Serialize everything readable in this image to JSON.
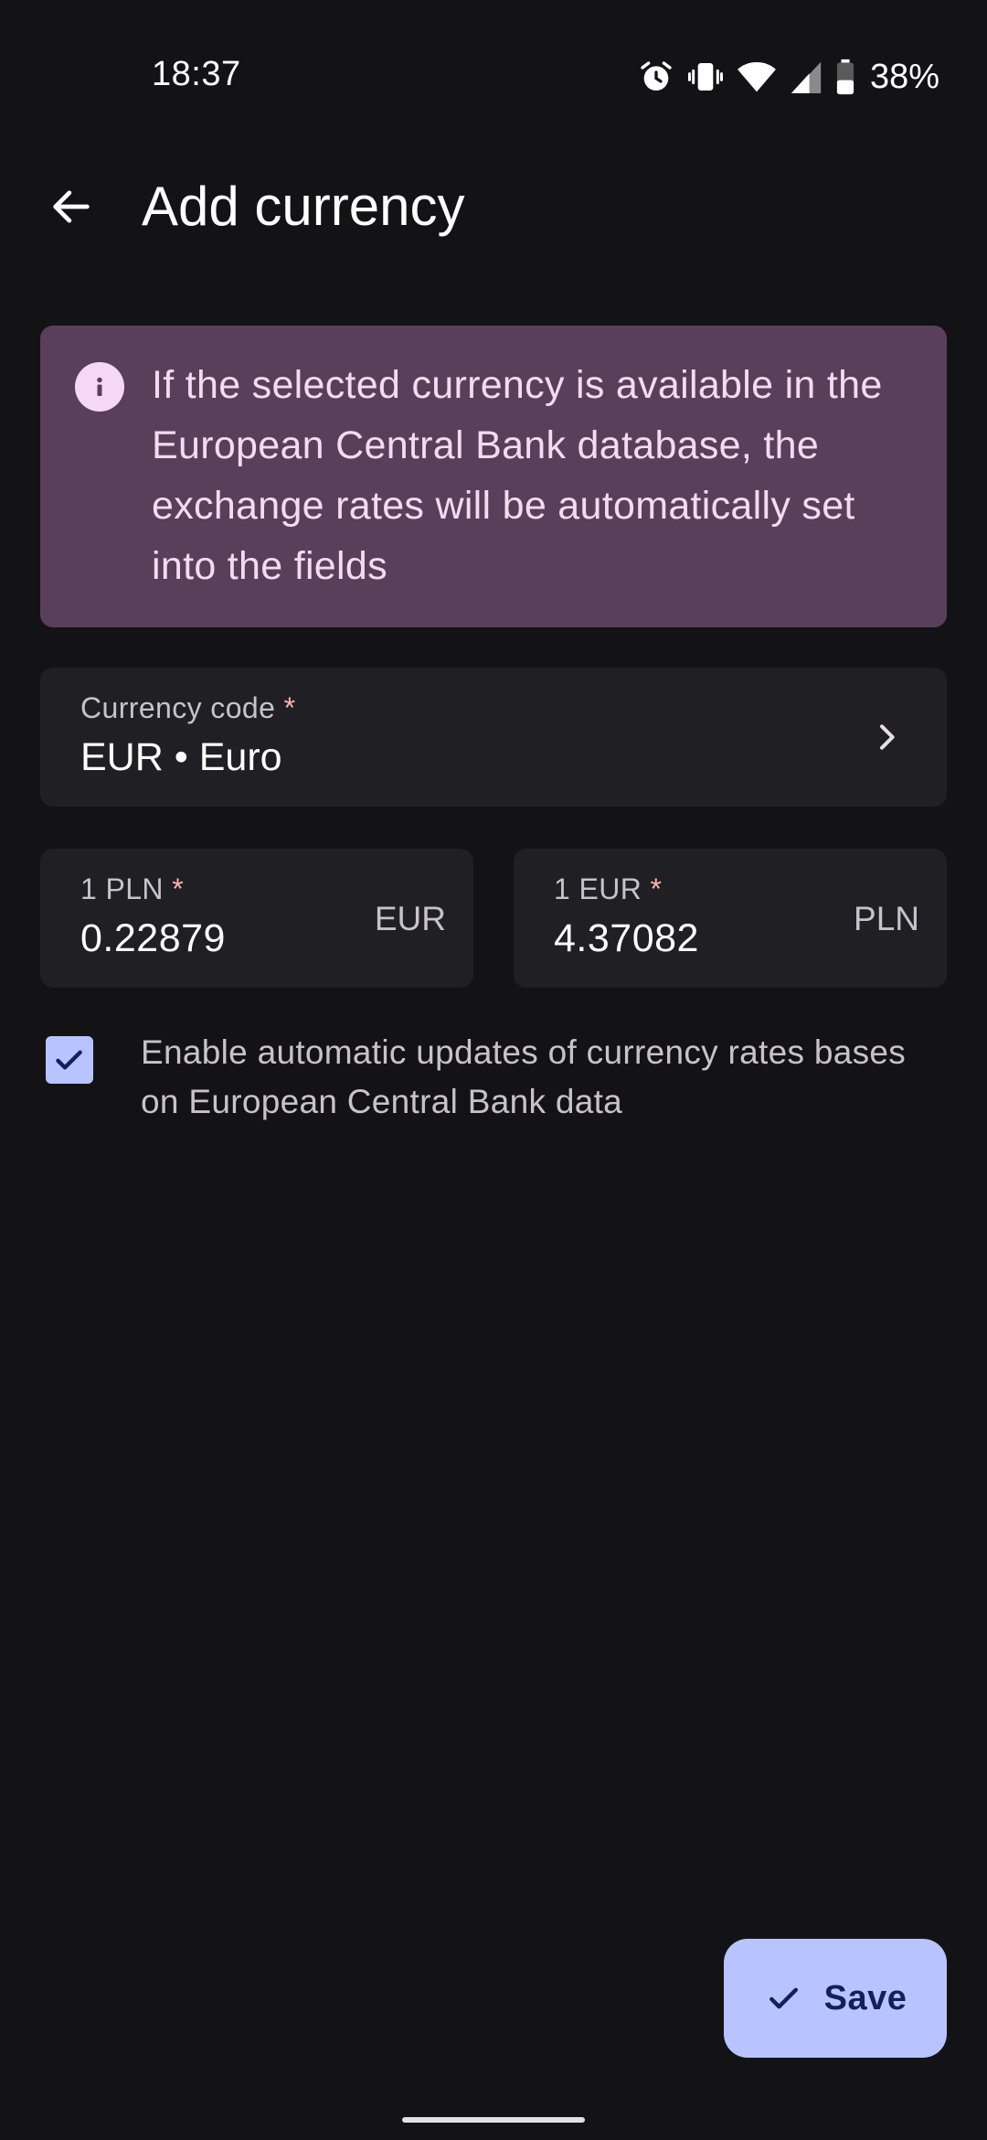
{
  "status_bar": {
    "time": "18:37",
    "battery_percent": "38%",
    "icons": [
      "alarm-icon",
      "vibrate-icon",
      "wifi-icon",
      "signal-icon",
      "battery-icon"
    ]
  },
  "top_bar": {
    "title": "Add currency",
    "back_icon": "arrow-back-icon"
  },
  "info_banner": {
    "icon": "info-icon",
    "text": "If the selected currency is available in the European Central Bank database, the exchange rates will be automatically set into the fields"
  },
  "currency_field": {
    "label": "Currency code",
    "required_mark": "*",
    "value": "EUR • Euro",
    "icon": "chevron-right-icon"
  },
  "rate_fields": [
    {
      "label": "1 PLN",
      "required_mark": "*",
      "value": "0.22879",
      "suffix": "EUR"
    },
    {
      "label": "1 EUR",
      "required_mark": "*",
      "value": "4.37082",
      "suffix": "PLN"
    }
  ],
  "auto_update": {
    "checked": true,
    "label": "Enable automatic updates of currency rates bases on European Central Bank data"
  },
  "save_button": {
    "label": "Save",
    "icon": "check-icon"
  },
  "colors": {
    "background": "#131316",
    "banner": "#5a3f5a",
    "field": "#1f1f24",
    "accent": "#b8c4ff",
    "required": "#ffb4ab"
  }
}
